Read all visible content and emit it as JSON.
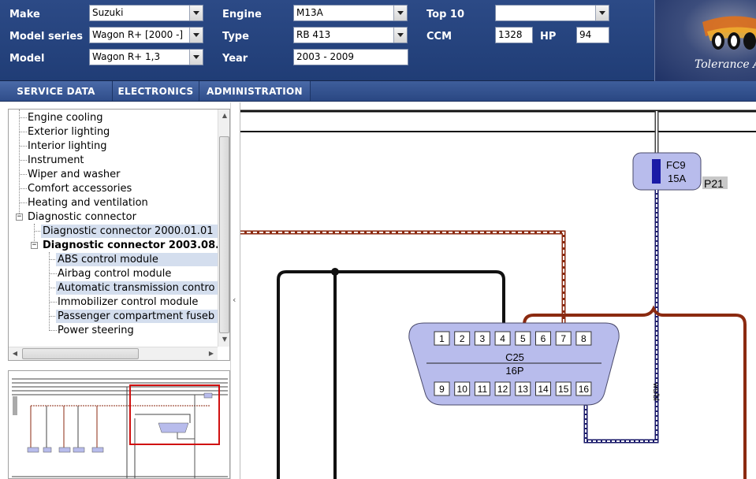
{
  "header": {
    "make_label": "Make",
    "make_value": "Suzuki",
    "model_series_label": "Model series",
    "model_series_value": "Wagon R+ [2000 -]",
    "model_label": "Model",
    "model_value": "Wagon R+ 1,3",
    "engine_label": "Engine",
    "engine_value": "M13A",
    "type_label": "Type",
    "type_value": "RB 413",
    "year_label": "Year",
    "year_value": "2003 - 2009",
    "top10_label": "Top 10",
    "top10_value": "",
    "ccm_label": "CCM",
    "ccm_value": "1328",
    "hp_label": "HP",
    "hp_value": "94",
    "logo_text": "Tolerance A"
  },
  "menu": {
    "items": [
      "SERVICE DATA",
      "ELECTRONICS",
      "ADMINISTRATION"
    ]
  },
  "tree": {
    "items": [
      {
        "label": "Engine cooling"
      },
      {
        "label": "Exterior lighting"
      },
      {
        "label": "Interior lighting"
      },
      {
        "label": "Instrument"
      },
      {
        "label": "Wiper and washer"
      },
      {
        "label": "Comfort accessories"
      },
      {
        "label": "Heating and ventilation"
      },
      {
        "label": "Diagnostic connector"
      },
      {
        "label": "Diagnostic connector 2000.01.01"
      },
      {
        "label": "Diagnostic connector 2003.08."
      },
      {
        "label": "ABS control module"
      },
      {
        "label": "Airbag control module"
      },
      {
        "label": "Automatic transmission contro"
      },
      {
        "label": "Immobilizer control module"
      },
      {
        "label": "Passenger compartment fuseb"
      },
      {
        "label": "Power steering"
      }
    ]
  },
  "diagram": {
    "fuse_label_1": "FC9",
    "fuse_label_2": "15A",
    "fuse_ref": "P21",
    "connector_name": "C25",
    "connector_type": "16P",
    "top_pins": [
      "1",
      "2",
      "3",
      "4",
      "5",
      "6",
      "7",
      "8"
    ],
    "bottom_pins": [
      "9",
      "10",
      "11",
      "12",
      "13",
      "14",
      "15",
      "16"
    ],
    "wire_label": "ws/bl",
    "colors": {
      "connector_fill": "#b8bcec",
      "fuse_fill": "#b8bcec",
      "fuse_element": "#1a1aa6",
      "brown_wire": "#8b2a10",
      "black_wire": "#111111"
    }
  },
  "thumbnail": {
    "highlight_color": "#d01010"
  }
}
